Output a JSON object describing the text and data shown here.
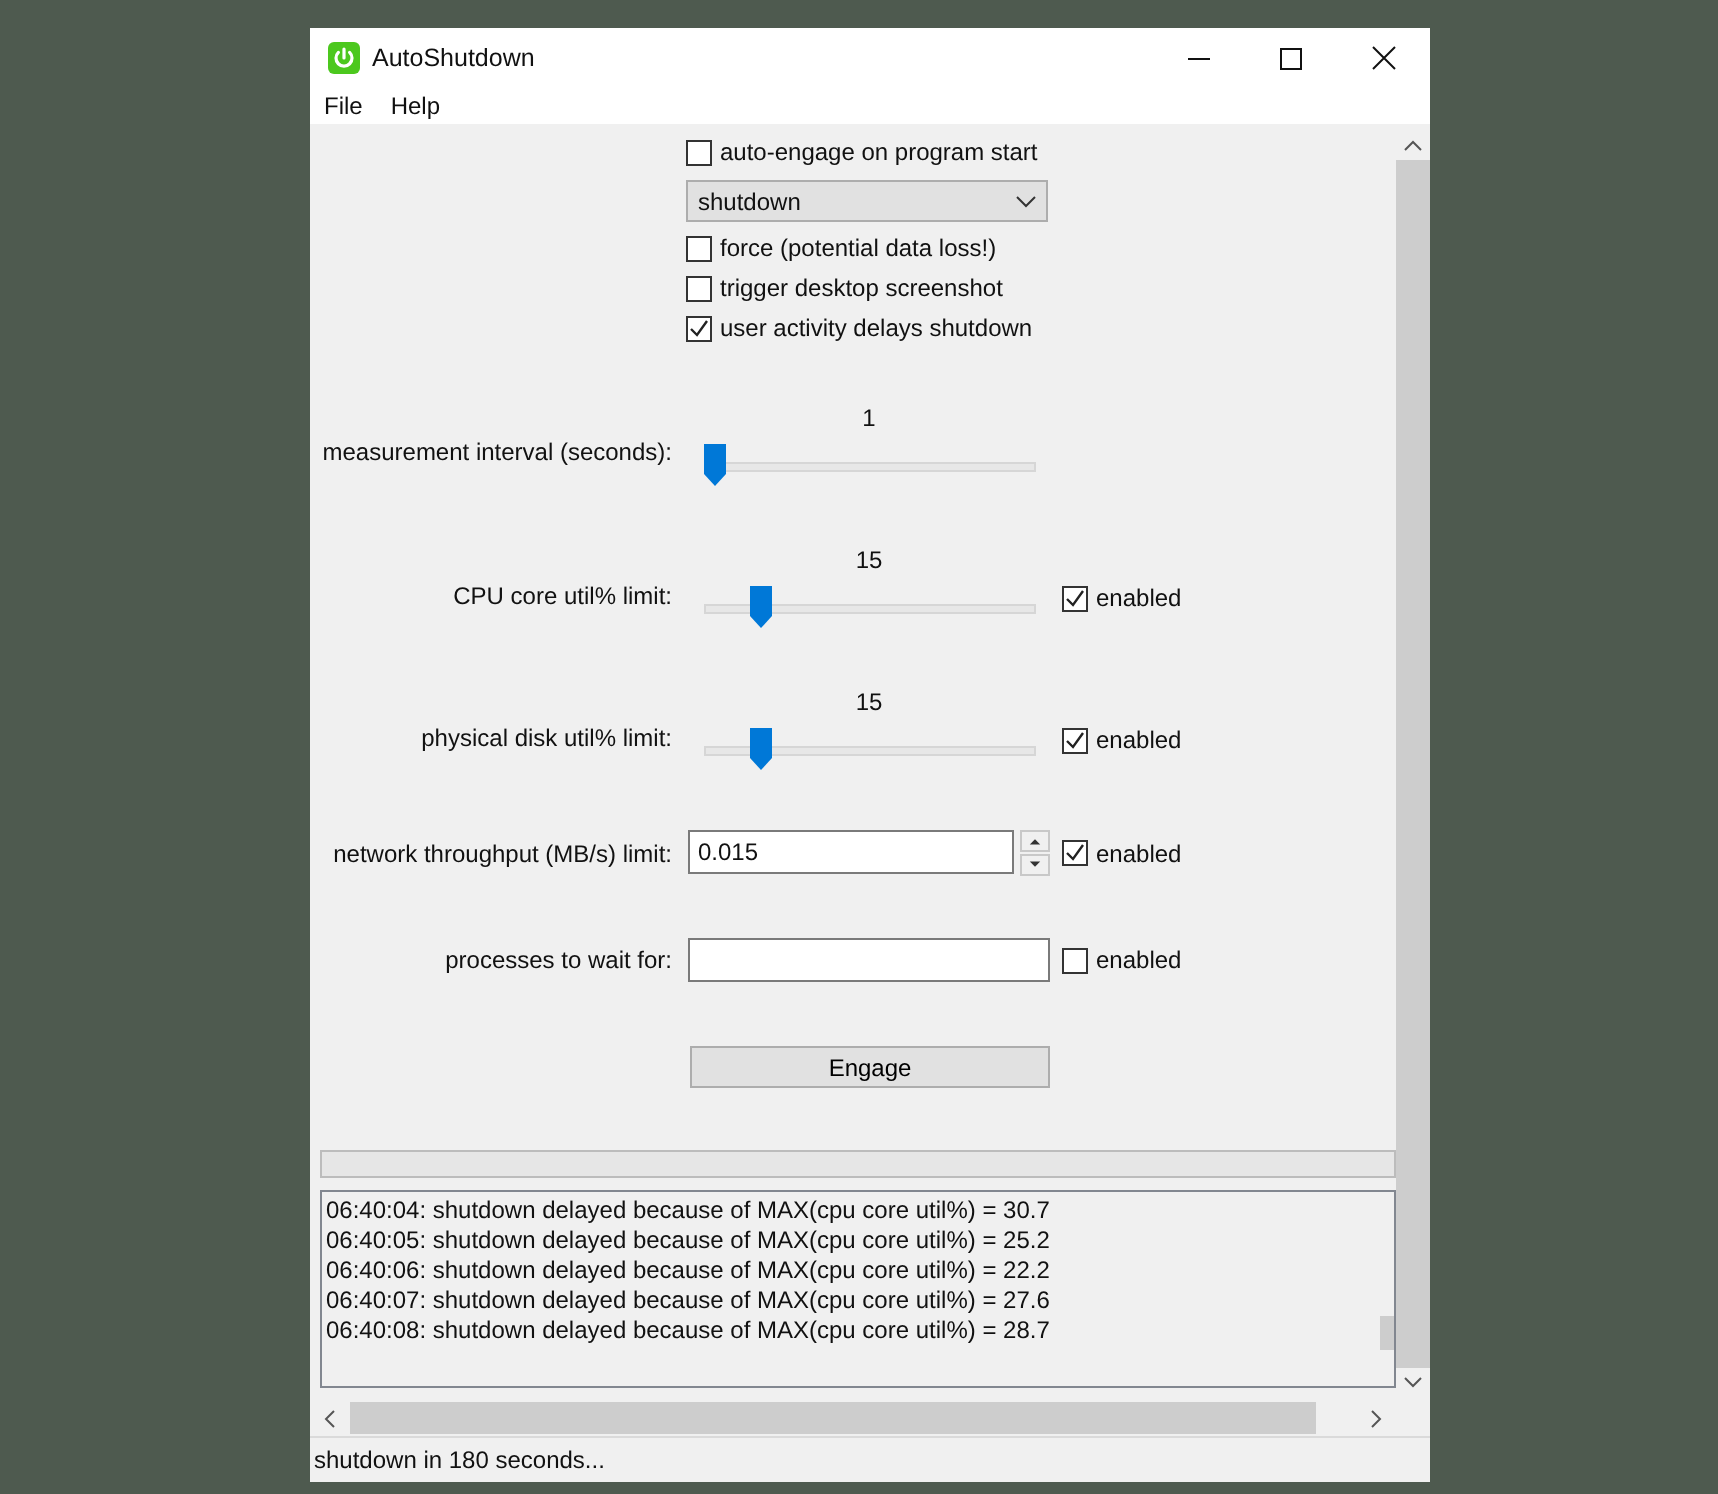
{
  "window": {
    "title": "AutoShutdown"
  },
  "menu": [
    "File",
    "Help"
  ],
  "auto_engage": {
    "label": "auto-engage on program start",
    "checked": false
  },
  "action_select": {
    "value": "shutdown"
  },
  "options": [
    {
      "label": "force (potential data loss!)",
      "checked": false
    },
    {
      "label": "trigger desktop screenshot",
      "checked": false
    },
    {
      "label": "user activity delays shutdown",
      "checked": true
    }
  ],
  "settings": [
    {
      "kind": "slider",
      "label": "measurement interval (seconds):",
      "value": "1",
      "level": 0
    },
    {
      "kind": "slider",
      "label": "CPU core util% limit:",
      "value": "15",
      "level": 0.15,
      "enabled_label": "enabled",
      "enabled": true
    },
    {
      "kind": "slider",
      "label": "physical disk util% limit:",
      "value": "15",
      "level": 0.15,
      "enabled_label": "enabled",
      "enabled": true
    },
    {
      "kind": "spin",
      "label": "network throughput (MB/s) limit:",
      "value": "0.015",
      "enabled_label": "enabled",
      "enabled": true
    },
    {
      "kind": "text",
      "label": "processes to wait for:",
      "enabled_label": "enabled",
      "enabled": false
    }
  ],
  "engage_button": "Engage",
  "progress": {
    "level": 0
  },
  "log": [
    "06:40:04: shutdown delayed because of MAX(cpu core util%) = 30.7",
    "06:40:05: shutdown delayed because of MAX(cpu core util%) = 25.2",
    "06:40:06: shutdown delayed because of MAX(cpu core util%) = 22.2",
    "06:40:07: shutdown delayed because of MAX(cpu core util%) = 27.6",
    "06:40:08: shutdown delayed because of MAX(cpu core util%) = 28.7"
  ],
  "status_bar": "shutdown in 180 seconds..."
}
